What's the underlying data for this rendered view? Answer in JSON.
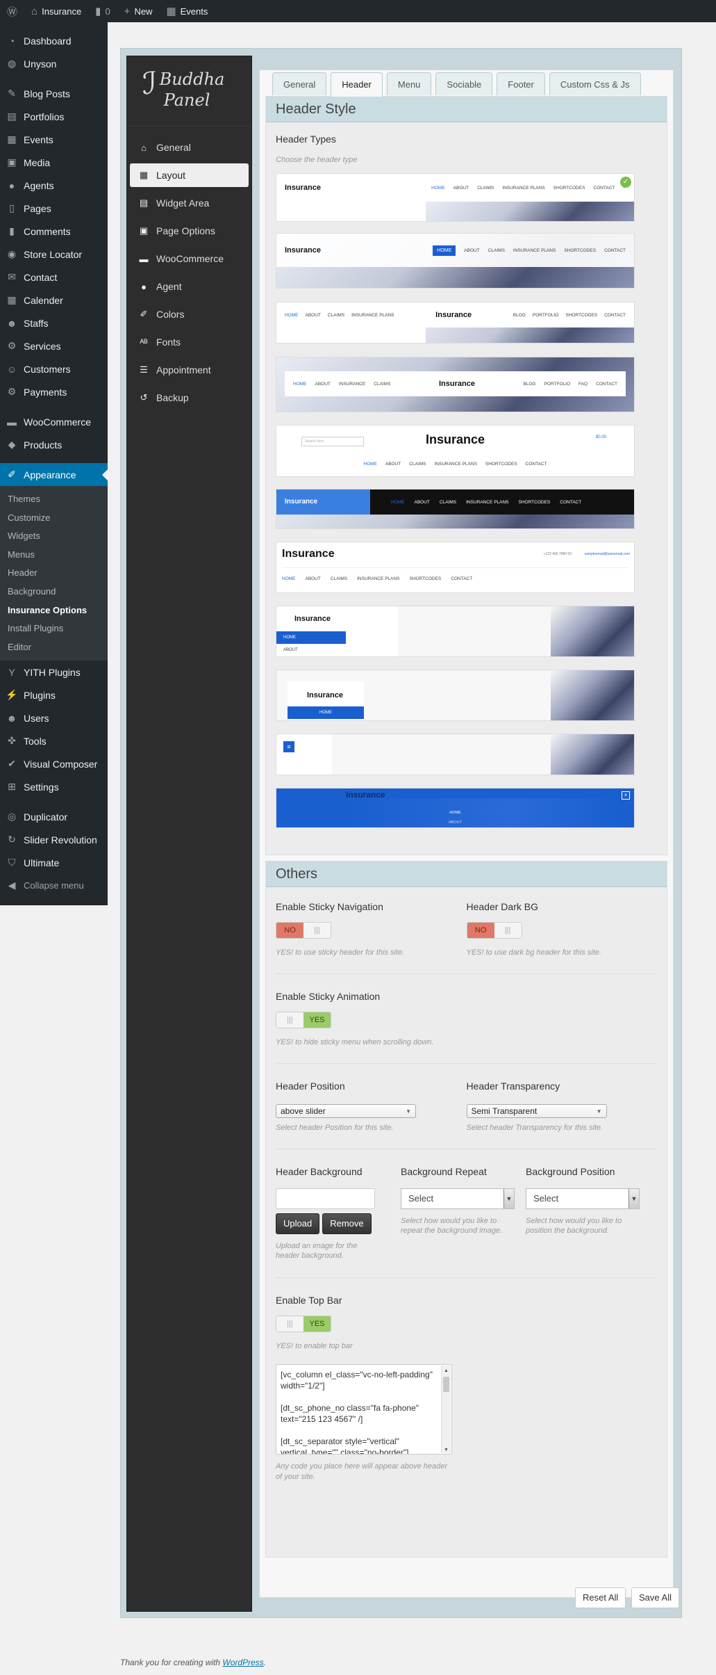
{
  "adminbar": {
    "site": "Insurance",
    "comments_count": "0",
    "new_label": "New",
    "events_label": "Events"
  },
  "sidemenu": {
    "items": [
      {
        "label": "Dashboard",
        "icon": "dashboard-icon"
      },
      {
        "label": "Unyson",
        "icon": "unyson-icon"
      },
      {
        "label": "Blog Posts",
        "icon": "pin-icon"
      },
      {
        "label": "Portfolios",
        "icon": "portfolio-icon"
      },
      {
        "label": "Events",
        "icon": "calendar-icon"
      },
      {
        "label": "Media",
        "icon": "media-icon"
      },
      {
        "label": "Agents",
        "icon": "user-icon"
      },
      {
        "label": "Pages",
        "icon": "page-icon"
      },
      {
        "label": "Comments",
        "icon": "comment-icon"
      },
      {
        "label": "Store Locator",
        "icon": "location-icon"
      },
      {
        "label": "Contact",
        "icon": "mail-icon"
      },
      {
        "label": "Calender",
        "icon": "calendar-icon"
      },
      {
        "label": "Staffs",
        "icon": "staff-icon"
      },
      {
        "label": "Services",
        "icon": "gear-icon"
      },
      {
        "label": "Customers",
        "icon": "customers-icon"
      },
      {
        "label": "Payments",
        "icon": "payments-icon"
      },
      {
        "label": "WooCommerce",
        "icon": "woo-icon"
      },
      {
        "label": "Products",
        "icon": "products-icon"
      },
      {
        "label": "Appearance",
        "icon": "brush-icon"
      }
    ],
    "submenu": [
      "Themes",
      "Customize",
      "Widgets",
      "Menus",
      "Header",
      "Background",
      "Insurance Options",
      "Install Plugins",
      "Editor"
    ],
    "items2": [
      {
        "label": "YITH Plugins",
        "icon": "yith-icon"
      },
      {
        "label": "Plugins",
        "icon": "plugin-icon"
      },
      {
        "label": "Users",
        "icon": "users-icon"
      },
      {
        "label": "Tools",
        "icon": "wrench-icon"
      },
      {
        "label": "Visual Composer",
        "icon": "vc-icon"
      },
      {
        "label": "Settings",
        "icon": "settings-icon"
      },
      {
        "label": "Duplicator",
        "icon": "duplicator-icon"
      },
      {
        "label": "Slider Revolution",
        "icon": "refresh-icon"
      },
      {
        "label": "Ultimate",
        "icon": "shield-icon"
      },
      {
        "label": "Collapse menu",
        "icon": "collapse-icon"
      }
    ]
  },
  "panel": {
    "logo_line1": "Buddha",
    "logo_line2": "Panel",
    "nav": [
      {
        "label": "General",
        "icon": "home-icon"
      },
      {
        "label": "Layout",
        "icon": "layout-icon"
      },
      {
        "label": "Widget Area",
        "icon": "widget-icon"
      },
      {
        "label": "Page Options",
        "icon": "page-options-icon"
      },
      {
        "label": "WooCommerce",
        "icon": "cart-icon"
      },
      {
        "label": "Agent",
        "icon": "user-icon"
      },
      {
        "label": "Colors",
        "icon": "brush-icon"
      },
      {
        "label": "Fonts",
        "icon": "font-icon"
      },
      {
        "label": "Appointment",
        "icon": "list-icon"
      },
      {
        "label": "Backup",
        "icon": "history-icon"
      }
    ],
    "tabs": [
      "General",
      "Header",
      "Menu",
      "Sociable",
      "Footer",
      "Custom Css & Js"
    ]
  },
  "header_style": {
    "title": "Header Style",
    "types_label": "Header Types",
    "types_desc": "Choose the header type",
    "brand": "Insurance",
    "thumb_nav1": [
      "HOME",
      "ABOUT",
      "CLAIMS",
      "INSURANCE PLANS",
      "SHORTCODES",
      "CONTACT"
    ],
    "thumb_nav2_left": [
      "HOME",
      "ABOUT",
      "CLAIMS",
      "INSURANCE PLANS"
    ],
    "thumb_nav2_right": [
      "BLOG",
      "PORTFOLIO",
      "SHORTCODES",
      "CONTACT"
    ],
    "thumb_nav3_left": [
      "HOME",
      "ABOUT",
      "INSURANCE",
      "CLAIMS"
    ],
    "thumb_nav3_right": [
      "BLOG",
      "PORTFOLIO",
      "FAQ",
      "CONTACT"
    ],
    "thumb_phone": "+123 456 7890 00",
    "thumb_email": "sampleemail@samemail.com",
    "thumb_search": "Search here",
    "thumb_cart": "$0.00",
    "home": "HOME",
    "about": "ABOUT"
  },
  "others": {
    "title": "Others",
    "sticky_nav": {
      "label": "Enable Sticky Navigation",
      "value": "NO",
      "desc": "YES! to use sticky header for this site."
    },
    "dark_bg": {
      "label": "Header Dark BG",
      "value": "NO",
      "desc": "YES! to use dark bg header for this site."
    },
    "sticky_anim": {
      "label": "Enable Sticky Animation",
      "value": "YES",
      "desc": "YES! to hide sticky menu when scrolling down."
    },
    "position": {
      "label": "Header Position",
      "value": "above slider",
      "desc": "Select header Position for this site."
    },
    "transparency": {
      "label": "Header Transparency",
      "value": "Semi Transparent",
      "desc": "Select header Transparency for this site."
    },
    "background": {
      "label": "Header Background",
      "upload": "Upload",
      "remove": "Remove",
      "desc": "Upload an image for the header background."
    },
    "repeat": {
      "label": "Background Repeat",
      "value": "Select",
      "desc": "Select how would you like to repeat the background image."
    },
    "bgpos": {
      "label": "Background Position",
      "value": "Select",
      "desc": "Select how would you like to position the background."
    },
    "topbar": {
      "label": "Enable Top Bar",
      "value": "YES",
      "desc": "YES! to enable top bar",
      "code": "[vc_column el_class=\"vc-no-left-padding\" width=\"1/2\"]\n\n[dt_sc_phone_no class=\"fa fa-phone\" text=\"215 123 4567\" /]\n\n[dt_sc_separator style=\"vertical\" vertical_type=\"\" class=\"no-border\"]",
      "code_desc": "Any code you place here will appear above header of your site."
    }
  },
  "actions": {
    "reset": "Reset All",
    "save": "Save All"
  },
  "footer": {
    "text": "Thank you for creating with ",
    "link": "WordPress",
    "end": "."
  }
}
